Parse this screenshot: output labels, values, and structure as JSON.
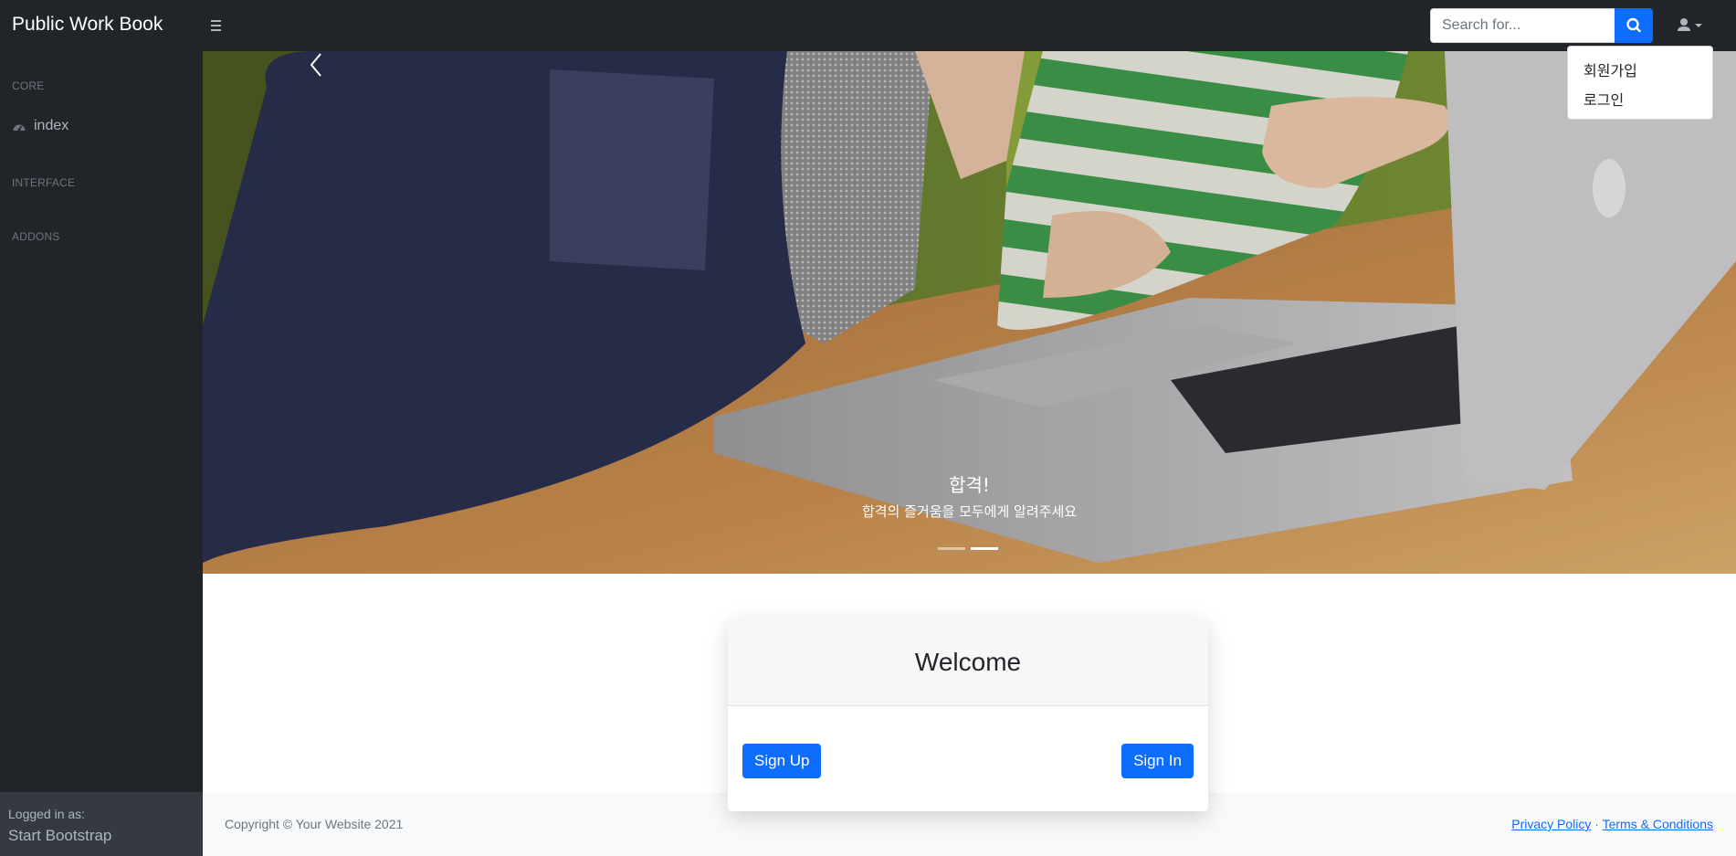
{
  "navbar": {
    "brand": "Public Work Book",
    "search": {
      "placeholder": "Search for...",
      "value": ""
    },
    "menu_icon": "hamburger-icon",
    "search_icon": "search-icon",
    "user_icon": "user-icon"
  },
  "user_menu": {
    "items": [
      {
        "label": "회원가입"
      },
      {
        "label": "로그인"
      }
    ]
  },
  "sidebar": {
    "sections": [
      {
        "heading": "CORE"
      },
      {
        "heading": "INTERFACE"
      },
      {
        "heading": "ADDONS"
      }
    ],
    "links": [
      {
        "label": "index",
        "icon": "dashboard-gauge-icon"
      }
    ],
    "footer": {
      "small": "Logged in as:",
      "name": "Start Bootstrap"
    }
  },
  "carousel": {
    "caption_title": "합격!",
    "caption_text": "합격의 즐거움을 모두에게 알려주세요",
    "slide_count": 2,
    "active_slide": 2
  },
  "welcome_card": {
    "title": "Welcome",
    "signup_label": "Sign Up",
    "signin_label": "Sign In"
  },
  "footer": {
    "copyright": "Copyright © Your Website 2021",
    "privacy": "Privacy Policy",
    "separator": "·",
    "terms": "Terms & Conditions"
  },
  "colors": {
    "nav_bg": "#212529",
    "primary": "#0d6efd",
    "footer_bg": "#f8f9fa",
    "sidebar_footer_bg": "#343a40"
  }
}
